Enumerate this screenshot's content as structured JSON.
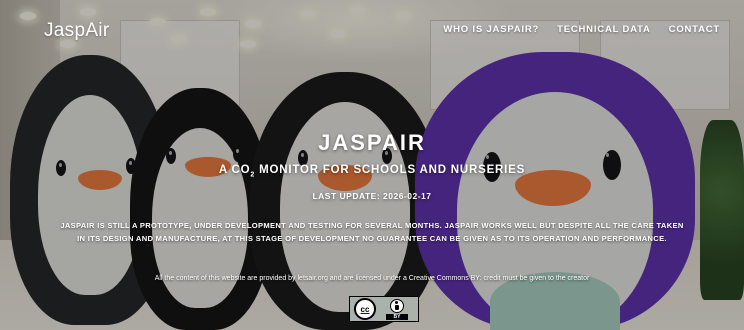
{
  "header": {
    "logo": "JaspAir",
    "nav": [
      {
        "label": "WHO IS JASPAIR?"
      },
      {
        "label": "TECHNICAL DATA"
      },
      {
        "label": "CONTACT"
      }
    ]
  },
  "hero": {
    "title": "JASPAIR",
    "subtitle_pre": "A CO",
    "subtitle_sub": "2",
    "subtitle_post": " MONITOR FOR SCHOOLS AND NURSERIES",
    "last_update": "LAST UPDATE: 2026-02-17"
  },
  "disclaimer": {
    "line1": "JASPAIR IS STILL A PROTOTYPE, UNDER DEVELOPMENT AND TESTING FOR SEVERAL MONTHS. JASPAIR WORKS WELL BUT DESPITE ALL THE CARE TAKEN",
    "line2": "IN ITS DESIGN AND MANUFACTURE, AT THIS STAGE OF DEVELOPMENT NO GUARANTEE CAN BE GIVEN AS TO ITS OPERATION AND PERFORMANCE."
  },
  "footer": {
    "license_text": "All the content of this website are provided by letsair.org and are licensed under a Creative Commons BY: credit must be given to the creator",
    "badge": {
      "cc": "cc",
      "by": "BY"
    }
  },
  "colors": {
    "accent_purple": "#5a2bb0",
    "beak_orange": "#ee7a3a"
  }
}
